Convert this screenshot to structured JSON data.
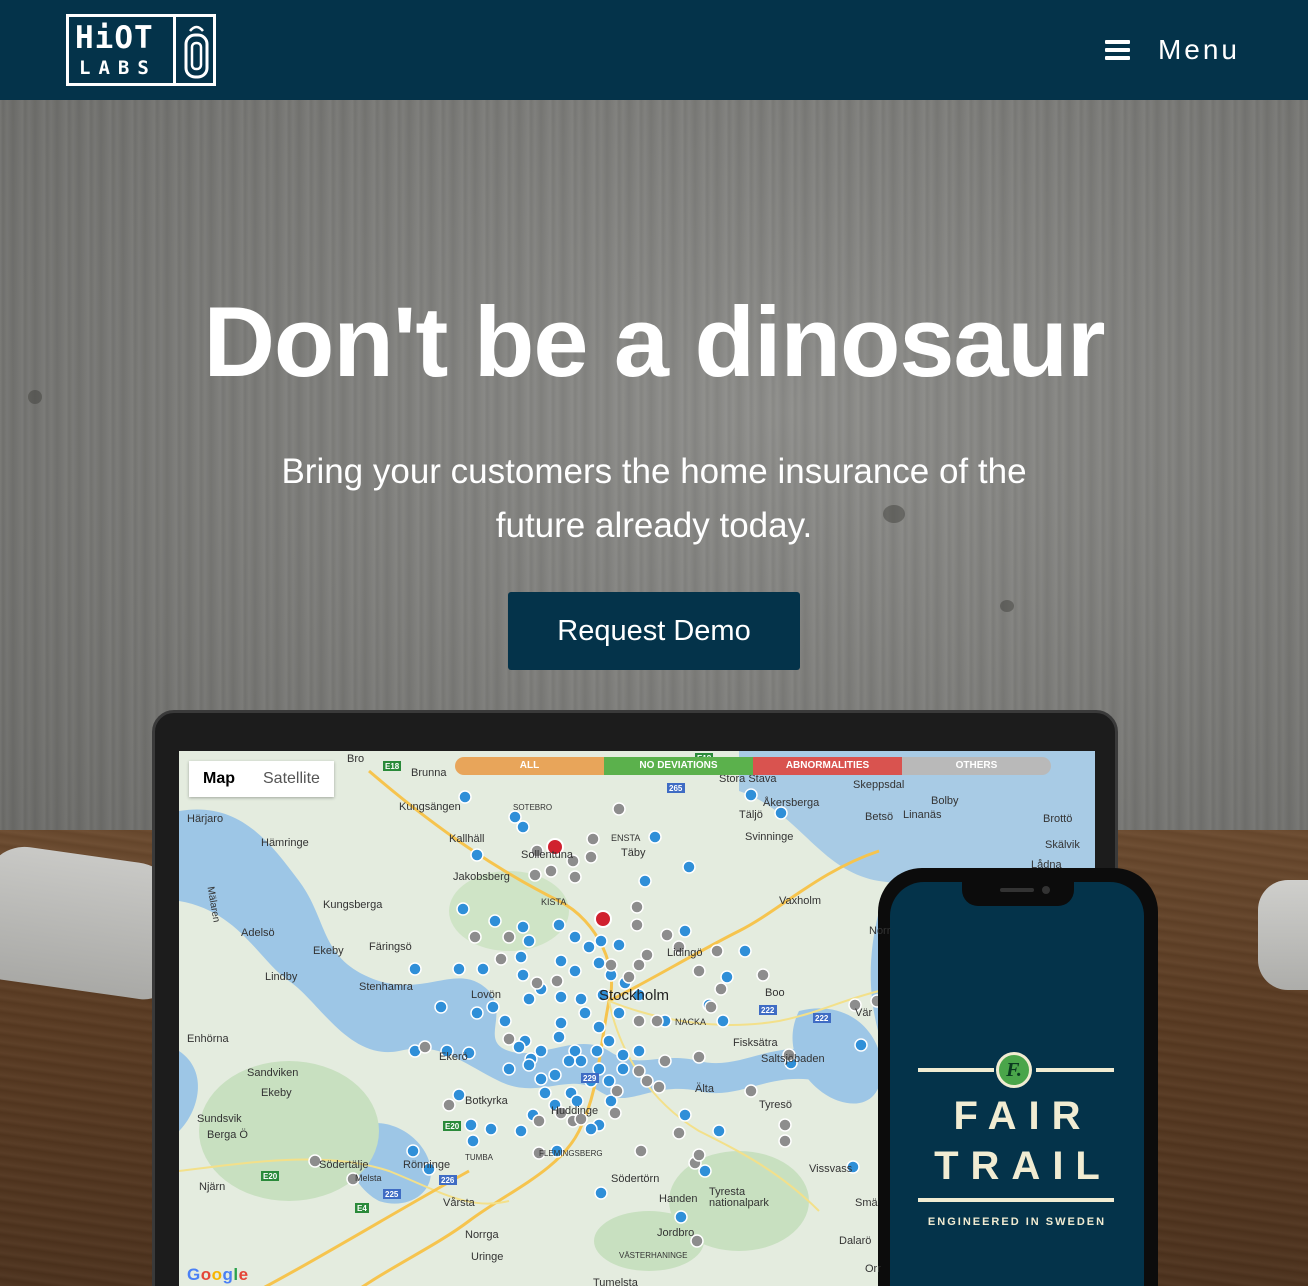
{
  "header": {
    "logo": {
      "top": "HiOT",
      "bottom": "LABS"
    },
    "menu_label": "Menu",
    "background": "#04334a"
  },
  "hero": {
    "title": "Don't be a dinosaur",
    "subtitle": "Bring your customers the home insurance of the future already today.",
    "cta_label": "Request Demo",
    "cta_color": "#04334a"
  },
  "map": {
    "toggle": {
      "map": "Map",
      "satellite": "Satellite",
      "selected": "Map"
    },
    "filters": [
      {
        "label": "ALL",
        "color": "#e8a55a"
      },
      {
        "label": "NO DEVIATIONS",
        "color": "#5bb14c"
      },
      {
        "label": "ABNORMALITIES",
        "color": "#d9534f"
      },
      {
        "label": "OTHERS",
        "color": "#b9b9b9"
      }
    ],
    "attribution": "Google",
    "places": [
      {
        "name": "Bro"
      },
      {
        "name": "Brunna"
      },
      {
        "name": "Kungsängen"
      },
      {
        "name": "Härjaro"
      },
      {
        "name": "Hämringe"
      },
      {
        "name": "Kallhäll"
      },
      {
        "name": "Sollentuna"
      },
      {
        "name": "Täby"
      },
      {
        "name": "ENSTA"
      },
      {
        "name": "Jakobsberg"
      },
      {
        "name": "KISTA"
      },
      {
        "name": "Kungsberga"
      },
      {
        "name": "Adelsö"
      },
      {
        "name": "Ekeby"
      },
      {
        "name": "Färingsö"
      },
      {
        "name": "Lindby"
      },
      {
        "name": "Stenhamra"
      },
      {
        "name": "Lovön"
      },
      {
        "name": "Stockholm"
      },
      {
        "name": "NACKA"
      },
      {
        "name": "Enhörna"
      },
      {
        "name": "Sandviken"
      },
      {
        "name": "Ekerö"
      },
      {
        "name": "Botkyrka"
      },
      {
        "name": "Huddinge"
      },
      {
        "name": "Sundsvik"
      },
      {
        "name": "Berga Ö"
      },
      {
        "name": "Södertälje"
      },
      {
        "name": "Rönninge"
      },
      {
        "name": "TUMBA"
      },
      {
        "name": "FLEMINGSBERG"
      },
      {
        "name": "Södertörn"
      },
      {
        "name": "Vårsta"
      },
      {
        "name": "Handen"
      },
      {
        "name": "Tyresta nationalpark"
      },
      {
        "name": "Norrga"
      },
      {
        "name": "Uringe"
      },
      {
        "name": "Jordbro"
      },
      {
        "name": "VÄSTERHANINGE"
      },
      {
        "name": "Stora Stava"
      },
      {
        "name": "Åkersberga"
      },
      {
        "name": "Täljö"
      },
      {
        "name": "Svinninge"
      },
      {
        "name": "Skeppsdal"
      },
      {
        "name": "Bolby"
      },
      {
        "name": "Betsö"
      },
      {
        "name": "Linanäs"
      },
      {
        "name": "Brottö"
      },
      {
        "name": "Skälvik"
      },
      {
        "name": "Vaxholm"
      },
      {
        "name": "Lidingö"
      },
      {
        "name": "Boo"
      },
      {
        "name": "Fisksätra"
      },
      {
        "name": "Saltsjöbaden"
      },
      {
        "name": "Älta"
      },
      {
        "name": "Tyresö"
      },
      {
        "name": "Vissvass"
      },
      {
        "name": "Dalarö"
      },
      {
        "name": "SOTEBRO"
      },
      {
        "name": "Mälaren"
      },
      {
        "name": "Njärn"
      },
      {
        "name": "Tumelsta"
      },
      {
        "name": "Vär"
      },
      {
        "name": "Smä"
      },
      {
        "name": "Lådna"
      },
      {
        "name": "Norr"
      },
      {
        "name": "Orr"
      },
      {
        "name": "Melsta"
      },
      {
        "name": "Ekeby"
      }
    ],
    "road_shields": [
      "E18",
      "E18",
      "265",
      "222",
      "222",
      "226",
      "E20",
      "E20",
      "229",
      "225",
      "226",
      "E4"
    ]
  },
  "phone_app": {
    "brand_line1": "FAIR",
    "brand_line2": "TRAIL",
    "badge": "F.",
    "tagline": "ENGINEERED IN SWEDEN",
    "background": "#04334a",
    "accent": "#f1ecd2"
  }
}
